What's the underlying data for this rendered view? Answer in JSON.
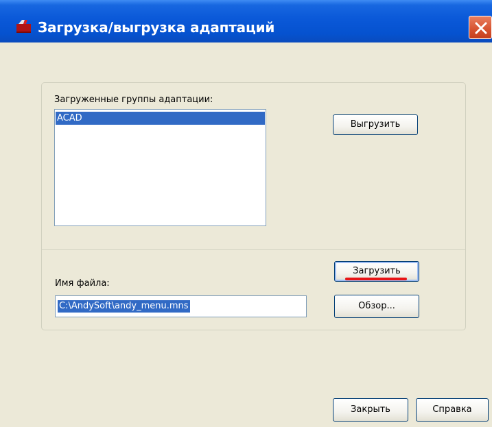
{
  "window": {
    "title": "Загрузка/выгрузка адаптаций",
    "title_icon": "acad-app-icon",
    "close_icon": "close-icon"
  },
  "loaded_groups": {
    "label": "Загруженные группы адаптации:",
    "items": [
      {
        "label": "ACAD",
        "selected": true
      }
    ],
    "unload_button": "Выгрузить"
  },
  "file": {
    "label": "Имя файла:",
    "value": "C:\\AndySoft\\andy_menu.mns",
    "load_button": "Загрузить",
    "browse_button": "Обзор..."
  },
  "footer": {
    "close_button": "Закрыть",
    "help_button": "Справка"
  },
  "colors": {
    "titlebar": "#0a58d8",
    "window_bg": "#ece9d8",
    "selection": "#316ac5",
    "close_button": "#d6522f",
    "annotation_underline": "#e81416"
  }
}
